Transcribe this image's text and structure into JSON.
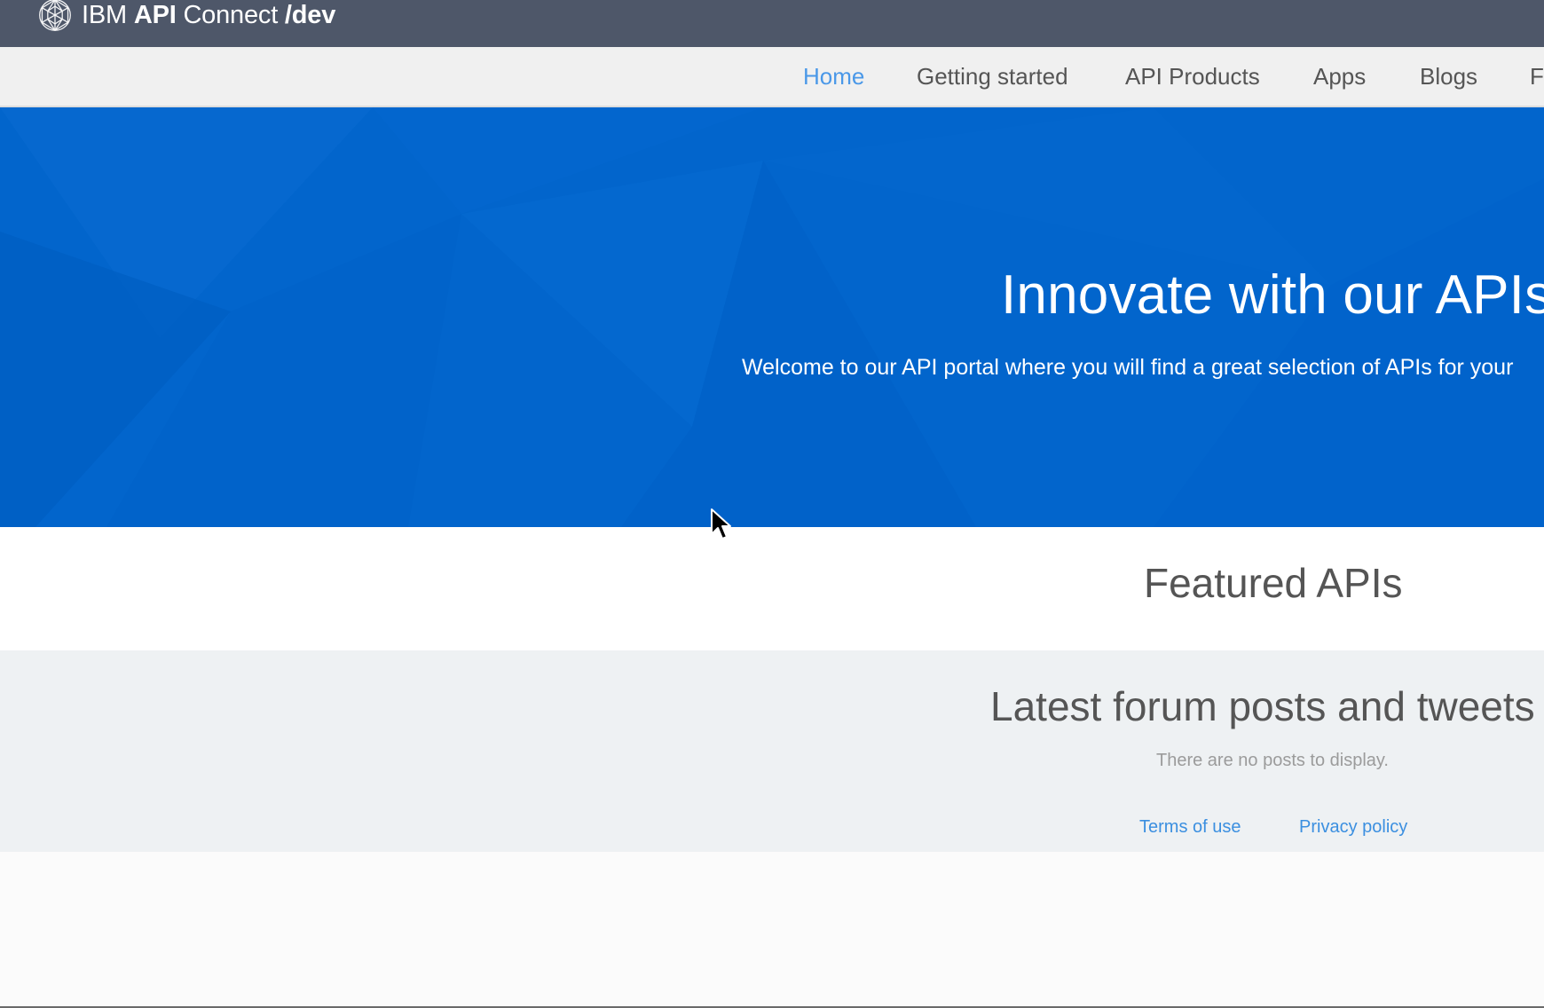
{
  "header": {
    "brand_prefix": "IBM",
    "brand_api": "API",
    "brand_connect": "Connect",
    "brand_suffix": "/dev",
    "logo_icon": "ibm-geodesic-sphere-icon"
  },
  "nav": {
    "items": [
      {
        "label": "Home",
        "active": true
      },
      {
        "label": "Getting started"
      },
      {
        "label": "API Products"
      },
      {
        "label": "Apps"
      },
      {
        "label": "Blogs"
      },
      {
        "label": "F"
      }
    ]
  },
  "hero": {
    "title": "Innovate with our APIs",
    "subtitle": "Welcome to our API portal where you will find a great selection of APIs for your"
  },
  "featured": {
    "heading": "Featured APIs"
  },
  "latest": {
    "heading": "Latest forum posts and tweets",
    "empty_message": "There are no posts to display."
  },
  "footer": {
    "terms": "Terms of use",
    "privacy": "Privacy policy"
  },
  "colors": {
    "topbar": "#4e5769",
    "nav_bg": "#f0f0f0",
    "nav_active": "#4a98e8",
    "hero_bg": "#0265cc",
    "latest_bg": "#eef1f3",
    "link": "#3b8fe0"
  },
  "cursor": {
    "icon": "mouse-pointer-icon"
  }
}
